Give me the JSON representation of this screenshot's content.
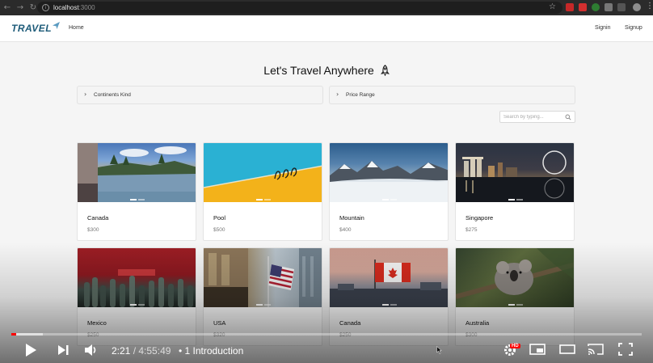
{
  "browser": {
    "url_host": "localhost",
    "url_port": ":3000"
  },
  "navbar": {
    "brand": "TRAVEL",
    "home": "Home",
    "signin": "Signin",
    "signup": "Signup"
  },
  "hero": {
    "title": "Let's Travel Anywhere"
  },
  "filters": {
    "continents": "Continents Kind",
    "price": "Price Range"
  },
  "search": {
    "placeholder": "Search by typing..."
  },
  "destinations": [
    {
      "name": "Canada",
      "price": "$300",
      "scene": "canada-lake"
    },
    {
      "name": "Pool",
      "price": "$500",
      "scene": "pool"
    },
    {
      "name": "Mountain",
      "price": "$400",
      "scene": "mountain"
    },
    {
      "name": "Singapore",
      "price": "$275",
      "scene": "singapore-night"
    },
    {
      "name": "Mexico",
      "price": "$250",
      "scene": "mexico"
    },
    {
      "name": "USA",
      "price": "$320",
      "scene": "usa-flag"
    },
    {
      "name": "Canada",
      "price": "$250",
      "scene": "canada-flag"
    },
    {
      "name": "Australia",
      "price": "$300",
      "scene": "koala"
    }
  ],
  "video": {
    "current": "2:21",
    "separator": " / ",
    "duration": "4:55:49",
    "chapter": "• 1 Introduction",
    "hd_badge": "HD",
    "played_fraction": 0.008,
    "buffered_fraction": 0.05
  },
  "colors": {
    "brand": "#1d5b79",
    "progress_played": "#ff0000",
    "browser_chrome": "#2b2b2b"
  }
}
